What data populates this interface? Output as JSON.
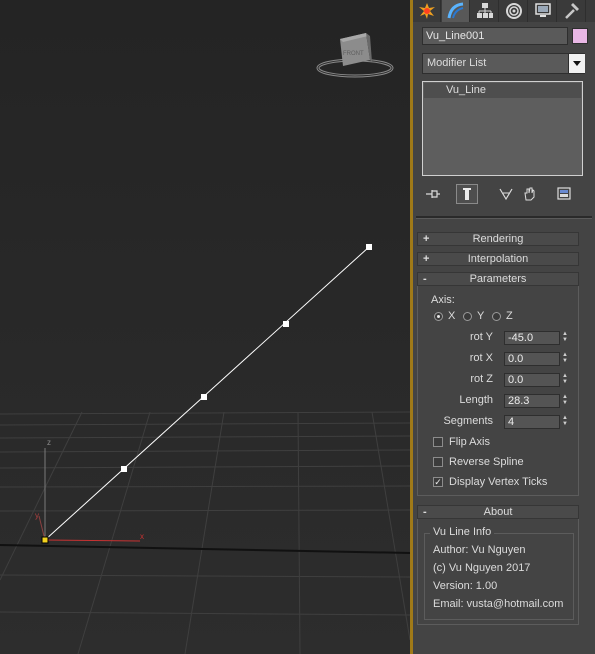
{
  "viewport": {
    "cube_label": "FRONT",
    "axis_x": "x",
    "axis_y": "y",
    "axis_z": "z"
  },
  "command_panel": {
    "tabs": [
      {
        "name": "create",
        "icon": "sun-star-icon"
      },
      {
        "name": "modify",
        "icon": "modify-arc-icon",
        "active": true
      },
      {
        "name": "hierarchy",
        "icon": "hierarchy-icon"
      },
      {
        "name": "motion",
        "icon": "motion-circle-icon"
      },
      {
        "name": "display",
        "icon": "monitor-icon"
      },
      {
        "name": "utilities",
        "icon": "hammer-icon"
      }
    ],
    "object_name": "Vu_Line001",
    "object_color": "#e9b7e5",
    "modifier_list": "Modifier List",
    "stack_items": [
      "Vu_Line"
    ]
  },
  "rollouts": {
    "rendering": {
      "sign": "+",
      "title": "Rendering"
    },
    "interpolation": {
      "sign": "+",
      "title": "Interpolation"
    },
    "parameters": {
      "sign": "-",
      "title": "Parameters",
      "axis_label": "Axis:",
      "axis_options": [
        "X",
        "Y",
        "Z"
      ],
      "axis_selected": "X",
      "rot_y_label": "rot Y",
      "rot_y": "-45.0",
      "rot_x_label": "rot X",
      "rot_x": "0.0",
      "rot_z_label": "rot Z",
      "rot_z": "0.0",
      "length_label": "Length",
      "length": "28.3",
      "segments_label": "Segments",
      "segments": "4",
      "flip_axis_label": "Flip Axis",
      "flip_axis": false,
      "reverse_spline_label": "Reverse Spline",
      "reverse_spline": false,
      "display_ticks_label": "Display Vertex Ticks",
      "display_ticks": true
    },
    "about": {
      "sign": "-",
      "title": "About",
      "group_title": "Vu Line Info",
      "author": "Author: Vu Nguyen",
      "copyright": "(c) Vu Nguyen 2017",
      "version": "Version: 1.00",
      "email": "Email: vusta@hotmail.com"
    }
  },
  "colors": {
    "accent_separator": "#a07a18",
    "panel_bg": "#444444",
    "viewport_bg": "#2b2b2b",
    "line": "#ffffff",
    "x_axis": "#c83232",
    "pivot": "#f2d21e"
  }
}
